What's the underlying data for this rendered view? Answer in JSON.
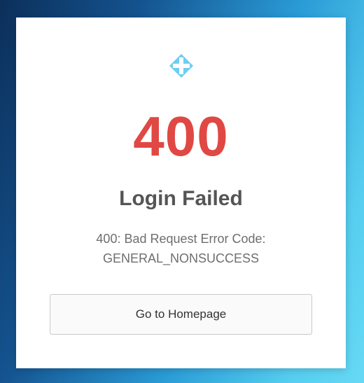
{
  "page": {
    "background_colors": [
      "#0c2f5a",
      "#14538f",
      "#2a9bd6",
      "#56cdef",
      "#66d9f5"
    ]
  },
  "card": {
    "logo_icon": "diamond-plus-icon",
    "logo_color": "#6fcdf2",
    "error_code": "400",
    "error_code_color": "#e04844",
    "title": "Login Failed",
    "message_line1": "400: Bad Request Error Code:",
    "message_line2": "GENERAL_NONSUCCESS",
    "button_label": "Go to Homepage"
  }
}
